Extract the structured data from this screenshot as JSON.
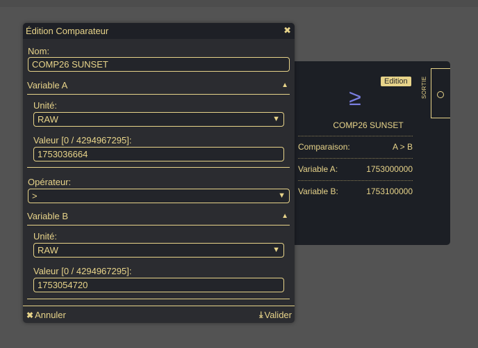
{
  "node": {
    "badge": "Edition",
    "port_label": "SORTIE",
    "operator_symbol": "≥",
    "name": "COMP26 SUNSET",
    "rows": [
      {
        "label": "Comparaison:",
        "value": "A > B"
      },
      {
        "label": "Variable A:",
        "value": "1753000000"
      },
      {
        "label": "Variable B:",
        "value": "1753100000"
      }
    ]
  },
  "modal": {
    "title": "Édition Comparateur",
    "name_label": "Nom:",
    "name_value": "COMP26 SUNSET",
    "variable_a": {
      "heading": "Variable A",
      "unit_label": "Unité:",
      "unit_value": "RAW",
      "value_label": "Valeur [0 / 4294967295]:",
      "value": "1753036664"
    },
    "operator_label": "Opérateur:",
    "operator_value": ">",
    "variable_b": {
      "heading": "Variable B",
      "unit_label": "Unité:",
      "unit_value": "RAW",
      "value_label": "Valeur [0 / 4294967295]:",
      "value": "1753054720"
    },
    "cancel_label": "Annuler",
    "save_label": "Valider"
  }
}
